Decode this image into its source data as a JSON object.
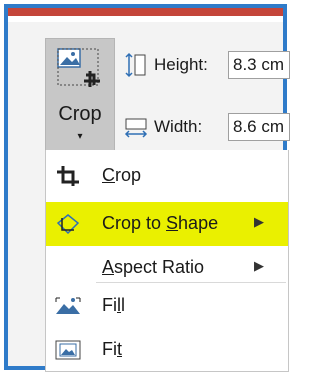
{
  "ribbon": {
    "crop_button": {
      "label": "Crop",
      "caret": "▾",
      "icon": "crop-image-icon"
    },
    "height": {
      "label": "Height:",
      "value": "8.3 cm",
      "icon": "height-icon"
    },
    "width": {
      "label": "Width:",
      "value": "8.6 cm",
      "icon": "width-icon"
    }
  },
  "menu": {
    "items": [
      {
        "label_prefix": "",
        "label_mnemonic": "C",
        "label_suffix": "rop",
        "icon": "crop-icon",
        "has_arrow": false
      },
      {
        "label_prefix": "Crop to ",
        "label_mnemonic": "S",
        "label_suffix": "hape",
        "icon": "crop-to-shape-icon",
        "has_arrow": true,
        "highlighted": true
      },
      {
        "label_prefix": "",
        "label_mnemonic": "A",
        "label_suffix": "spect Ratio",
        "icon": "",
        "has_arrow": true
      },
      {
        "label_prefix": "Fi",
        "label_mnemonic": "l",
        "label_suffix": "l",
        "icon": "fill-icon",
        "has_arrow": false
      },
      {
        "label_prefix": "Fi",
        "label_mnemonic": "t",
        "label_suffix": "",
        "icon": "fit-icon",
        "has_arrow": false
      }
    ],
    "submenu_arrow": "▶"
  },
  "colors": {
    "highlight": "#ebf000",
    "frame_border": "#2f7bc9",
    "accent": "#c4453a",
    "button_pressed": "#c7c7c7"
  }
}
